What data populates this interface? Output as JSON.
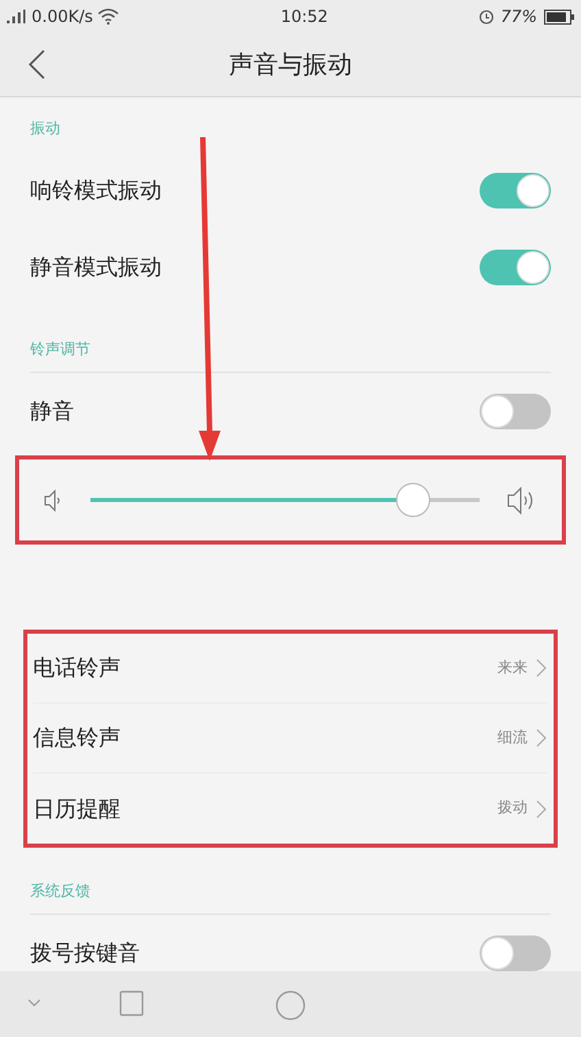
{
  "status_bar": {
    "network_speed": "0.00K/s",
    "time": "10:52",
    "battery": "77%"
  },
  "header": {
    "title": "声音与振动"
  },
  "sections": [
    {
      "title": "振动",
      "highlighted": false,
      "items": [
        {
          "kind": "toggle",
          "label": "响铃模式振动",
          "on": true
        },
        {
          "kind": "toggle",
          "label": "静音模式振动",
          "on": true
        }
      ]
    },
    {
      "title": "铃声调节",
      "highlighted": false,
      "items": [
        {
          "kind": "toggle",
          "label": "静音",
          "on": false
        },
        {
          "kind": "slider",
          "level": 0.86,
          "highlighted": true
        }
      ]
    },
    {
      "highlighted": true,
      "items": [
        {
          "kind": "link",
          "label": "电话铃声",
          "value": "来来"
        },
        {
          "kind": "link",
          "label": "信息铃声",
          "value": "细流"
        },
        {
          "kind": "link",
          "label": "日历提醒",
          "value": "拨动"
        }
      ]
    },
    {
      "title": "系统反馈",
      "highlighted": false,
      "items": [
        {
          "kind": "toggle",
          "label": "拨号按键音",
          "on": false
        }
      ]
    }
  ]
}
